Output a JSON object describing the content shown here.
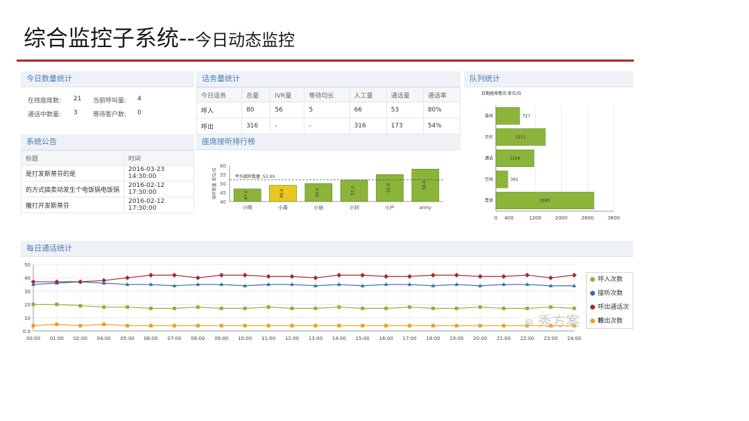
{
  "title": {
    "main": "综合监控子系统--",
    "sub": "今日动态监控"
  },
  "today_stats": {
    "header": "今日数量统计",
    "items": [
      {
        "label": "在线座席数:",
        "value": "21"
      },
      {
        "label": "当前呼叫量:",
        "value": "4"
      },
      {
        "label": "通话中数量:",
        "value": "3"
      },
      {
        "label": "等待客户数:",
        "value": "0"
      }
    ]
  },
  "traffic": {
    "header": "话务量统计",
    "columns": [
      "今日话务",
      "总量",
      "IVR量",
      "等待均长",
      "人工量",
      "通话量",
      "通话率"
    ],
    "rows": [
      [
        "呼入",
        "80",
        "56",
        "5",
        "66",
        "53",
        "80%"
      ],
      [
        "呼出",
        "316",
        "-",
        "-",
        "316",
        "173",
        "54%"
      ]
    ]
  },
  "notice": {
    "header": "系统公告",
    "columns": [
      "标题",
      "时间"
    ],
    "rows": [
      [
        "是打发斯蒂芬的是",
        "2016-03-23 14:30:00"
      ],
      [
        "的方式搞卖动发生个电饭锅电饭锅",
        "2016-02-12 17:30:00"
      ],
      [
        "撒打开发斯蒂芬",
        "2016-02-12 17:30:00"
      ]
    ]
  },
  "ranking": {
    "header": "座席接听排行榜",
    "chart_data": {
      "type": "bar",
      "categories": [
        "小明",
        "小周",
        "小张",
        "小刘",
        "小户",
        "anny"
      ],
      "values": [
        47,
        49,
        50,
        52,
        55,
        58
      ],
      "ylabel": "接听数量 单位/位",
      "ylim": [
        40,
        60
      ],
      "yticks": [
        40,
        45,
        50,
        55,
        60
      ],
      "avg_label": "平均接听数量: 52.00",
      "avg_value": 52,
      "colors": [
        "#8db43a",
        "#e8c81e",
        "#8db43a",
        "#8db43a",
        "#8db43a",
        "#8db43a"
      ]
    }
  },
  "queue": {
    "header": "队列统计",
    "chart_data": {
      "type": "bar",
      "title": "日期座席情况  单位/位",
      "categories": [
        "等待",
        "示忙",
        "通话",
        "空闲",
        "登录"
      ],
      "values": [
        727,
        1511,
        1164,
        361,
        2995
      ],
      "xlim": [
        0,
        3600
      ],
      "xticks": [
        "0",
        "400",
        "1200",
        "2000",
        "2800",
        "3600"
      ],
      "color": "#8db43a"
    }
  },
  "daily": {
    "header": "每日通话统计",
    "chart_data": {
      "type": "line",
      "x": [
        "00:00",
        "01:00",
        "02:00",
        "04:00",
        "05:00",
        "06:00",
        "07:00",
        "08:00",
        "09:00",
        "10:00",
        "11:00",
        "12:00",
        "13:00",
        "14:00",
        "15:00",
        "16:00",
        "17:00",
        "18:00",
        "19:00",
        "20:00",
        "21:00",
        "22:00",
        "23:00",
        "24:00"
      ],
      "ylim": [
        0,
        50
      ],
      "yticks": [
        "0.0",
        "10",
        "20",
        "30",
        "40",
        "50"
      ],
      "series": [
        {
          "name": "呼入次数",
          "color": "#8db43a",
          "values": [
            20,
            20,
            19,
            18,
            18,
            17,
            17,
            18,
            17,
            17,
            18,
            17,
            17,
            18,
            17,
            17,
            18,
            17,
            17,
            18,
            17,
            17,
            18,
            17
          ]
        },
        {
          "name": "接听次数",
          "color": "#2f6fb4",
          "values": [
            35,
            36,
            37,
            36,
            35,
            35,
            34,
            35,
            35,
            34,
            35,
            35,
            34,
            35,
            34,
            35,
            35,
            34,
            35,
            34,
            35,
            35,
            34,
            34
          ]
        },
        {
          "name": "呼出通话次数",
          "color": "#a42a35",
          "values": [
            37,
            37,
            37,
            38,
            40,
            42,
            42,
            40,
            42,
            42,
            41,
            41,
            40,
            42,
            42,
            41,
            41,
            42,
            42,
            41,
            41,
            42,
            40,
            42
          ]
        },
        {
          "name": "呼出次数",
          "color": "#f39c1f",
          "values": [
            4,
            5,
            4,
            5,
            4,
            4,
            4,
            4,
            4,
            4,
            4,
            4,
            4,
            4,
            4,
            4,
            4,
            4,
            4,
            4,
            4,
            4,
            4,
            4
          ]
        }
      ]
    }
  },
  "watermark": "秀方案",
  "icons": {
    "watermark": "wechat-icon"
  }
}
